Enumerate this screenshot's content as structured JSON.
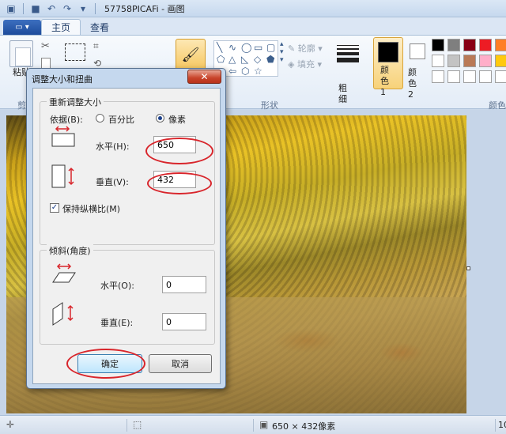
{
  "window": {
    "title": "57758PICAFi - 画图"
  },
  "tabs": [
    {
      "label": "主页"
    },
    {
      "label": "查看"
    }
  ],
  "ribbon": {
    "paste_label": "粘贴",
    "clipboard_label": "剪",
    "outline_label": "轮廓",
    "fill_label": "填充",
    "shapes_group_label": "形状",
    "thickness_label": "粗细",
    "color1_label": "颜色 1",
    "color2_label": "颜色 2",
    "colors_group_label": "颜色",
    "palette": [
      "#000000",
      "#7f7f7f",
      "#880015",
      "#ed1c24",
      "#ff7f27",
      "#ffffff",
      "#c3c3c3",
      "#b97a57",
      "#ffaec9",
      "#ffc90e",
      "#ffffff",
      "#ffffff",
      "#ffffff",
      "#ffffff",
      "#ffffff"
    ]
  },
  "dialog": {
    "title": "调整大小和扭曲",
    "resize_group": "重新调整大小",
    "basis_label": "依据(B):",
    "option_percent": "百分比",
    "option_pixels": "像素",
    "selected_option": "像素",
    "horizontal_label": "水平(H):",
    "horizontal_value": "650",
    "vertical_label": "垂直(V):",
    "vertical_value": "432",
    "keep_ratio_label": "保持纵横比(M)",
    "keep_ratio_checked": true,
    "skew_group": "倾斜(角度)",
    "skew_horizontal_label": "水平(O):",
    "skew_horizontal_value": "0",
    "skew_vertical_label": "垂直(E):",
    "skew_vertical_value": "0",
    "ok_label": "确定",
    "cancel_label": "取消"
  },
  "status": {
    "image_size": "650 × 432像素",
    "zoom": "10"
  },
  "highlight_color": "#d8252b"
}
